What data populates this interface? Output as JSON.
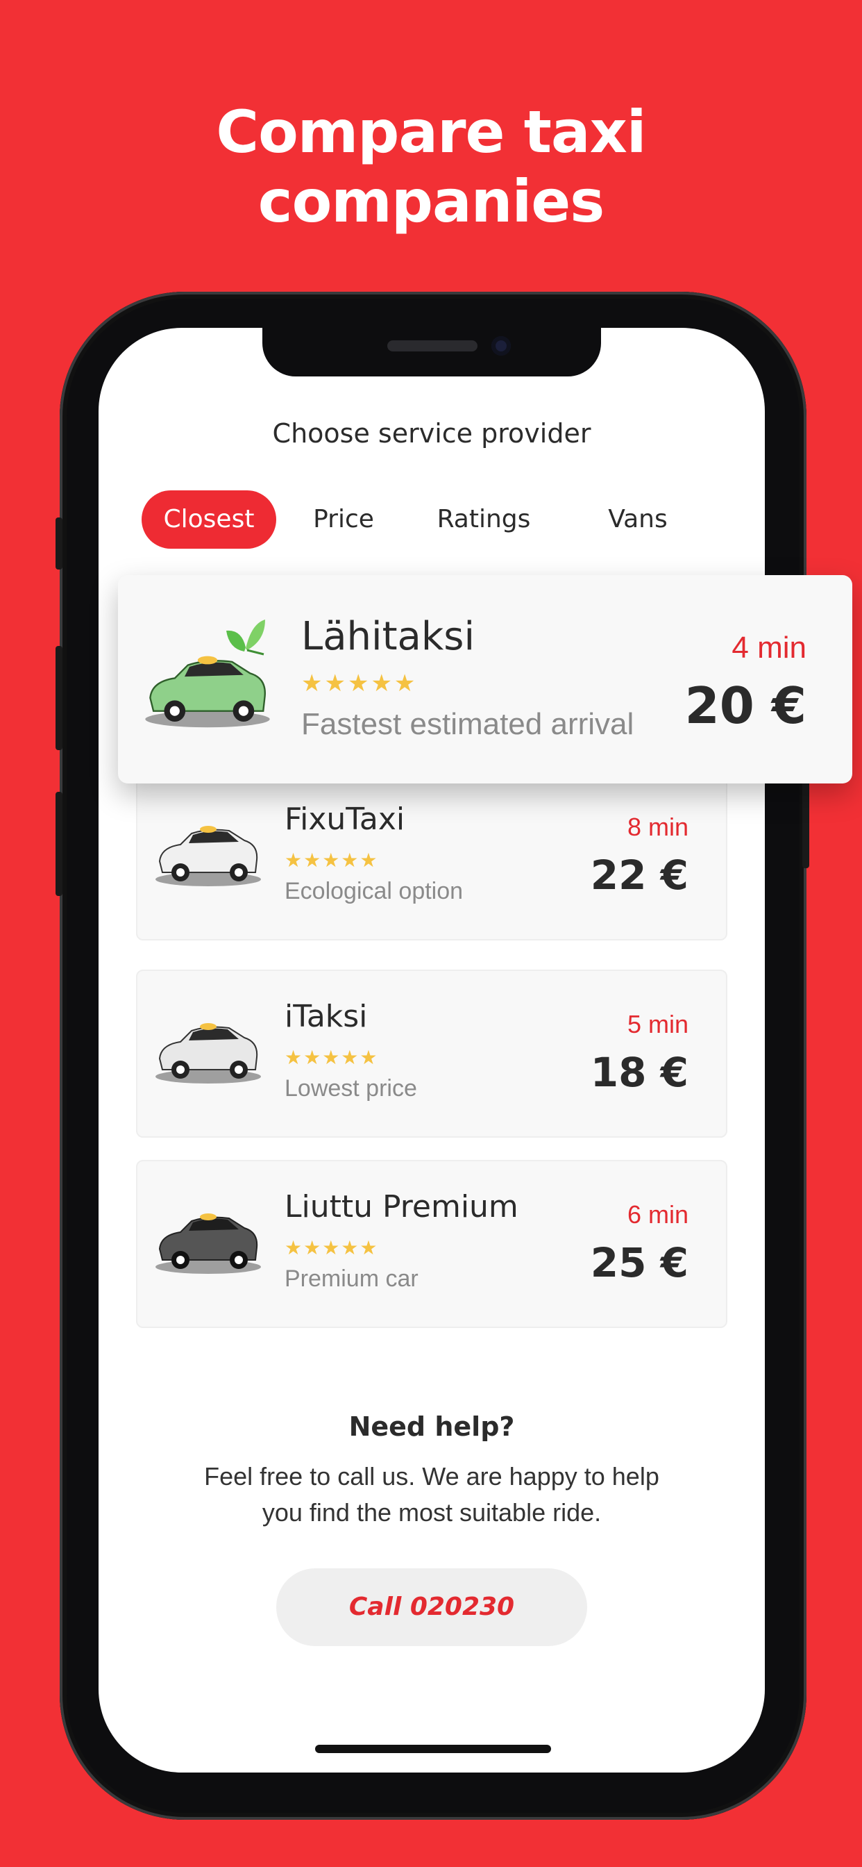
{
  "headline": {
    "line1": "Compare taxi",
    "line2": "companies"
  },
  "screen": {
    "title": "Choose service provider"
  },
  "tabs": [
    {
      "label": "Closest",
      "active": true
    },
    {
      "label": "Price",
      "active": false
    },
    {
      "label": "Ratings",
      "active": false
    },
    {
      "label": "Vans",
      "active": false
    }
  ],
  "featured": {
    "name": "Lähitaksi",
    "stars": "★★★★★",
    "rating": 5,
    "tag": "Fastest estimated arrival",
    "eta": "4 min",
    "price": "20 €",
    "car_color": "#8fd08a",
    "icon": "leaf-icon"
  },
  "providers": [
    {
      "name": "FixuTaxi",
      "stars": "★★★★★",
      "rating": 5,
      "tag": "Ecological option",
      "eta": "8 min",
      "price": "22 €",
      "car_color": "#f0f0f0"
    },
    {
      "name": "iTaksi",
      "stars": "★★★★★",
      "rating": 5,
      "tag": "Lowest price",
      "eta": "5 min",
      "price": "18 €",
      "car_color": "#e8e8e8"
    },
    {
      "name": "Liuttu Premium",
      "stars": "★★★★★",
      "rating": 5,
      "tag": "Premium car",
      "eta": "6 min",
      "price": "25 €",
      "car_color": "#555555"
    }
  ],
  "help": {
    "title": "Need help?",
    "text_line1": "Feel free to call us. We are happy to help",
    "text_line2": "you find the most suitable ride.",
    "call_label": "Call 020230"
  },
  "colors": {
    "background": "#f23035",
    "accent": "#e32a30",
    "star": "#f5c242"
  }
}
